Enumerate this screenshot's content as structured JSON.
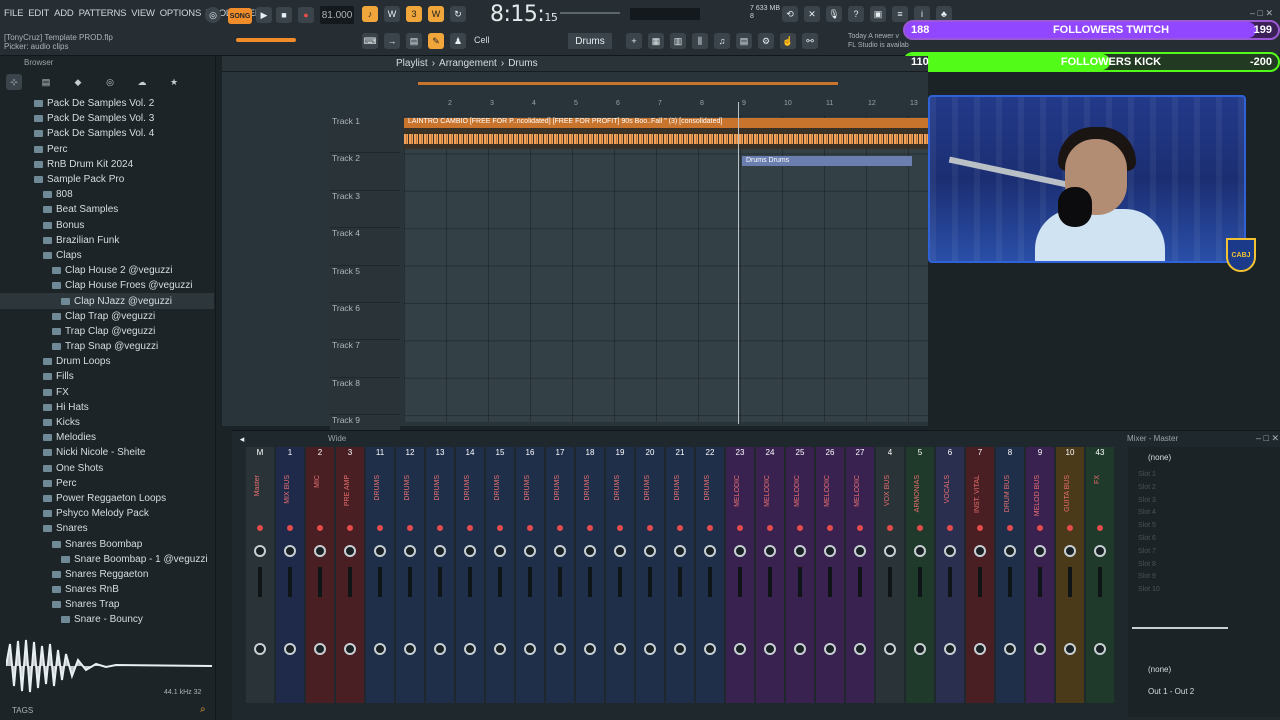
{
  "menu": [
    "FILE",
    "EDIT",
    "ADD",
    "PATTERNS",
    "VIEW",
    "OPTIONS",
    "TOOLS",
    "HELP"
  ],
  "hint": {
    "project": "[TonyCruz] Template PROD.flp",
    "picker": "Picker: audio clips"
  },
  "transport": {
    "mode": "SONG",
    "tempo": "81.000",
    "time_main": "8:15:",
    "time_ticks": "15",
    "cpu": "7",
    "mem": "633 MB",
    "voices": "8"
  },
  "pattern": "Drums",
  "snap": "Cell",
  "news": {
    "line1": "Today A newer v",
    "line2": "FL Studio is availab"
  },
  "followers": {
    "twitch": {
      "label": "FOLLOWERS TWITCH",
      "current": "188",
      "goal": "199",
      "progress": 0.94
    },
    "kick": {
      "label": "FOLLOWERS KICK",
      "current": "110",
      "goal": "-200",
      "progress": 0.55
    }
  },
  "browser": {
    "title": "Browser",
    "tags": "TAGS",
    "samplerate": "44.1 kHz 32",
    "tree": [
      {
        "label": "Pack De Samples Vol. 2",
        "indent": 0
      },
      {
        "label": "Pack De Samples Vol. 3",
        "indent": 0
      },
      {
        "label": "Pack De Samples Vol. 4",
        "indent": 0
      },
      {
        "label": "Perc",
        "indent": 0
      },
      {
        "label": "RnB Drum Kit 2024",
        "indent": 0
      },
      {
        "label": "Sample Pack Pro",
        "indent": 0
      },
      {
        "label": "808",
        "indent": 1
      },
      {
        "label": "Beat Samples",
        "indent": 1
      },
      {
        "label": "Bonus",
        "indent": 1
      },
      {
        "label": "Brazilian Funk",
        "indent": 1
      },
      {
        "label": "Claps",
        "indent": 1
      },
      {
        "label": "Clap House 2 @veguzzi",
        "indent": 2
      },
      {
        "label": "Clap House Froes @veguzzi",
        "indent": 2
      },
      {
        "label": "Clap NJazz @veguzzi",
        "indent": 3,
        "selected": true
      },
      {
        "label": "Clap Trap @veguzzi",
        "indent": 2
      },
      {
        "label": "Trap Clap @veguzzi",
        "indent": 2
      },
      {
        "label": "Trap Snap @veguzzi",
        "indent": 2
      },
      {
        "label": "Drum Loops",
        "indent": 1
      },
      {
        "label": "Fills",
        "indent": 1
      },
      {
        "label": "FX",
        "indent": 1
      },
      {
        "label": "Hi Hats",
        "indent": 1
      },
      {
        "label": "Kicks",
        "indent": 1
      },
      {
        "label": "Melodies",
        "indent": 1
      },
      {
        "label": "Nicki Nicole - Sheite",
        "indent": 1
      },
      {
        "label": "One Shots",
        "indent": 1
      },
      {
        "label": "Perc",
        "indent": 1
      },
      {
        "label": "Power Reggaeton Loops",
        "indent": 1
      },
      {
        "label": "Pshyco Melody Pack",
        "indent": 1
      },
      {
        "label": "Snares",
        "indent": 1
      },
      {
        "label": "Snares Boombap",
        "indent": 2
      },
      {
        "label": "Snare Boombap - 1 @veguzzi",
        "indent": 3
      },
      {
        "label": "Snares Reggaeton",
        "indent": 2
      },
      {
        "label": "Snares RnB",
        "indent": 2
      },
      {
        "label": "Snares Trap",
        "indent": 2
      },
      {
        "label": "Snare - Bouncy",
        "indent": 3
      }
    ]
  },
  "rack": [
    "[FREE FOR PROFIT] 9...",
    "[FREE FOR PROFIT] 9...",
    "LAINTRO",
    "[FREE FOR PROFIT] 9...",
    "CAMBIO"
  ],
  "playlist": {
    "breadcrumb": [
      "Playlist",
      "Arrangement",
      "Drums"
    ],
    "ruler": [
      "2",
      "3",
      "4",
      "5",
      "6",
      "7",
      "8",
      "9",
      "10",
      "11",
      "12",
      "13"
    ],
    "tracks": [
      "Track 1",
      "Track 2",
      "Track 3",
      "Track 4",
      "Track 5",
      "Track 6",
      "Track 7",
      "Track 8",
      "Track 9"
    ],
    "clip1": "LAINTRO          CAMBIO          [FREE FOR P..ncolidated]  [FREE FOR PROFIT] 90s Boo..Fall \" (3) [consolidated]",
    "clip2": "Drums          Drums"
  },
  "mixer": {
    "title": "Mixer - Master",
    "wide": "Wide",
    "insert_none": "(none)",
    "output_none": "(none)",
    "output": "Out 1 - Out 2",
    "strips": [
      {
        "num": "M",
        "label": "Master",
        "color": "#2a3338"
      },
      {
        "num": "1",
        "label": "MIX BUS",
        "color": "#1f2a4a"
      },
      {
        "num": "2",
        "label": "MIC",
        "color": "#4a1f24"
      },
      {
        "num": "3",
        "label": "PRE AMP",
        "color": "#4a1f24"
      },
      {
        "num": "11",
        "label": "DRUMS",
        "color": "#1f2f4a"
      },
      {
        "num": "12",
        "label": "DRUMS",
        "color": "#1f2f4a"
      },
      {
        "num": "13",
        "label": "DRUMS",
        "color": "#1f2f4a"
      },
      {
        "num": "14",
        "label": "DRUMS",
        "color": "#1f2f4a"
      },
      {
        "num": "15",
        "label": "DRUMS",
        "color": "#1f2f4a"
      },
      {
        "num": "16",
        "label": "DRUMS",
        "color": "#1f2f4a"
      },
      {
        "num": "17",
        "label": "DRUMS",
        "color": "#1f2f4a"
      },
      {
        "num": "18",
        "label": "DRUMS",
        "color": "#1f2f4a"
      },
      {
        "num": "19",
        "label": "DRUMS",
        "color": "#1f2f4a"
      },
      {
        "num": "20",
        "label": "DRUMS",
        "color": "#1f2f4a"
      },
      {
        "num": "21",
        "label": "DRUMS",
        "color": "#1f2f4a"
      },
      {
        "num": "22",
        "label": "DRUMS",
        "color": "#1f2f4a"
      },
      {
        "num": "23",
        "label": "MELODIC",
        "color": "#3a2250"
      },
      {
        "num": "24",
        "label": "MELODIC",
        "color": "#3a2250"
      },
      {
        "num": "25",
        "label": "MELODIC",
        "color": "#3a2250"
      },
      {
        "num": "26",
        "label": "MELODIC",
        "color": "#3a2250"
      },
      {
        "num": "27",
        "label": "MELODIC",
        "color": "#3a2250"
      },
      {
        "num": "4",
        "label": "VOX BUS",
        "color": "#2a3338"
      },
      {
        "num": "5",
        "label": "ARMONIAS",
        "color": "#1f3a2a"
      },
      {
        "num": "6",
        "label": "VOCALS",
        "color": "#2a2f50"
      },
      {
        "num": "7",
        "label": "INST. VITAL",
        "color": "#4a1f24"
      },
      {
        "num": "8",
        "label": "DRUM BUS",
        "color": "#1f2f4a"
      },
      {
        "num": "9",
        "label": "MELOD BUS",
        "color": "#3a2250"
      },
      {
        "num": "10",
        "label": "GUITA BUS",
        "color": "#4a3a1a"
      },
      {
        "num": "43",
        "label": "FX",
        "color": "#1f3a2a"
      }
    ]
  },
  "colors": {
    "accent": "#f08c2a",
    "twitch": "#9146ff",
    "kick": "#53fc18",
    "cam_border": "#2f62d6"
  }
}
